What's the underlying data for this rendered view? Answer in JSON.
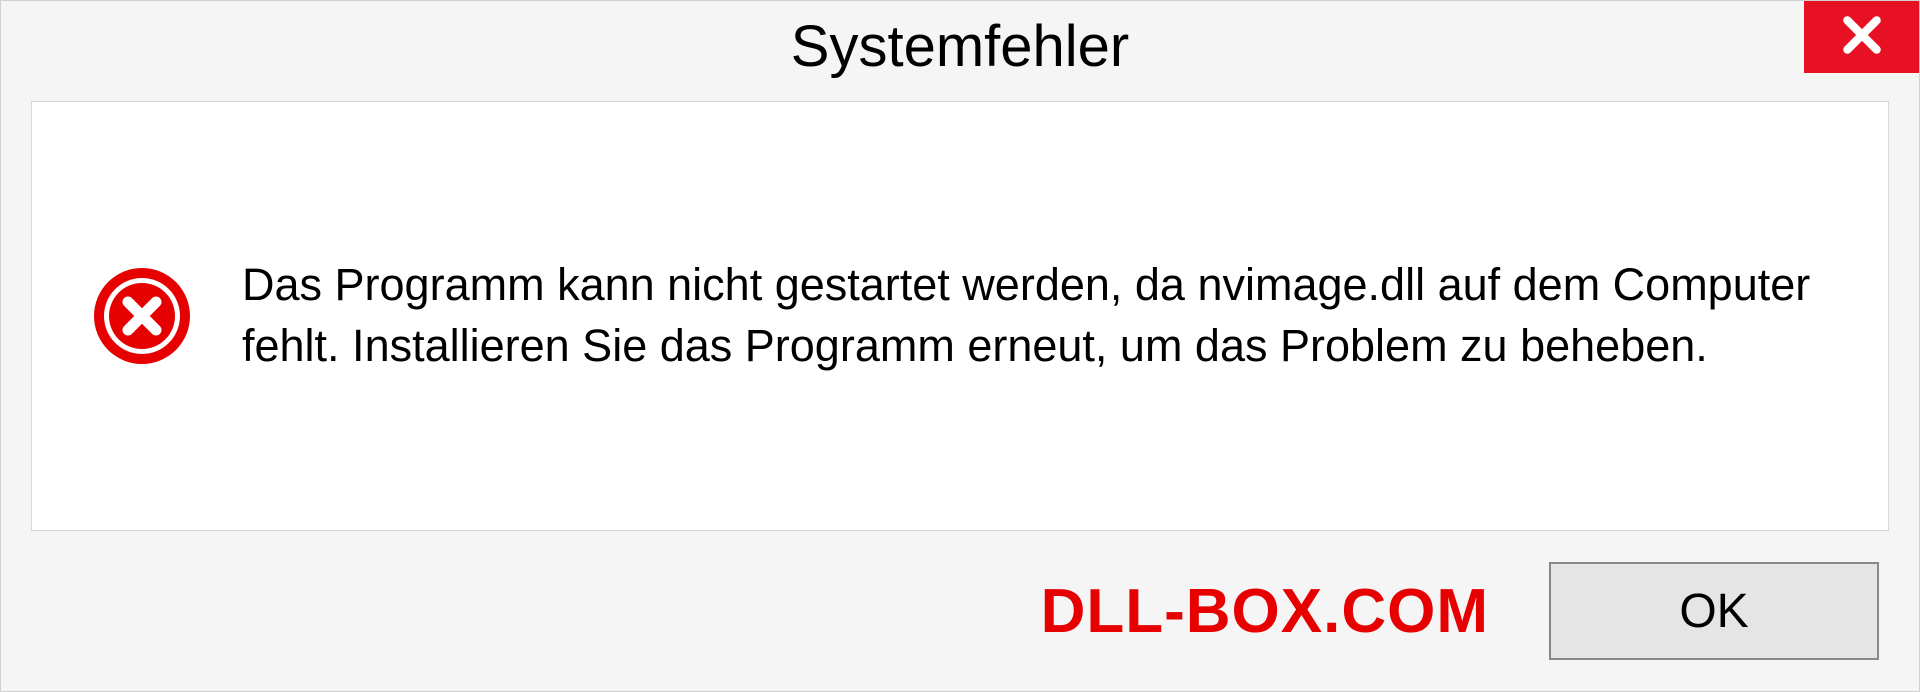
{
  "dialog": {
    "title": "Systemfehler",
    "message": "Das Programm kann nicht gestartet werden, da nvimage.dll auf dem Computer fehlt. Installieren Sie das Programm erneut, um das Problem zu beheben.",
    "ok_label": "OK"
  },
  "watermark": "DLL-BOX.COM",
  "colors": {
    "close_bg": "#e81123",
    "error_icon": "#e60000",
    "watermark": "#e60000"
  }
}
